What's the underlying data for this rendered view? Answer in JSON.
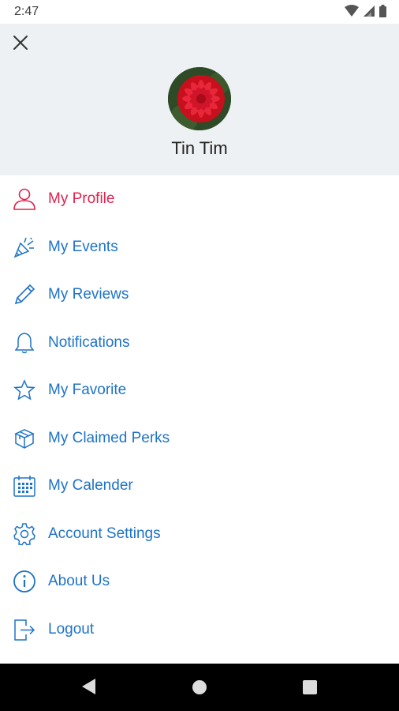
{
  "status_bar": {
    "time": "2:47"
  },
  "header": {
    "user_name": "Tin Tim"
  },
  "menu": {
    "items": [
      {
        "label": "My Profile",
        "icon": "user-icon",
        "active": true
      },
      {
        "label": "My Events",
        "icon": "party-popper-icon"
      },
      {
        "label": "My Reviews",
        "icon": "pencil-icon"
      },
      {
        "label": "Notifications",
        "icon": "bell-icon"
      },
      {
        "label": "My Favorite",
        "icon": "star-icon"
      },
      {
        "label": "My Claimed Perks",
        "icon": "gift-box-icon"
      },
      {
        "label": "My Calender",
        "icon": "calendar-icon"
      },
      {
        "label": "Account Settings",
        "icon": "gear-icon"
      },
      {
        "label": "About Us",
        "icon": "info-icon"
      },
      {
        "label": "Logout",
        "icon": "logout-icon"
      }
    ]
  },
  "colors": {
    "accent_blue": "#1e73c8",
    "active_red": "#e0234f",
    "header_bg": "#eef1f4"
  }
}
